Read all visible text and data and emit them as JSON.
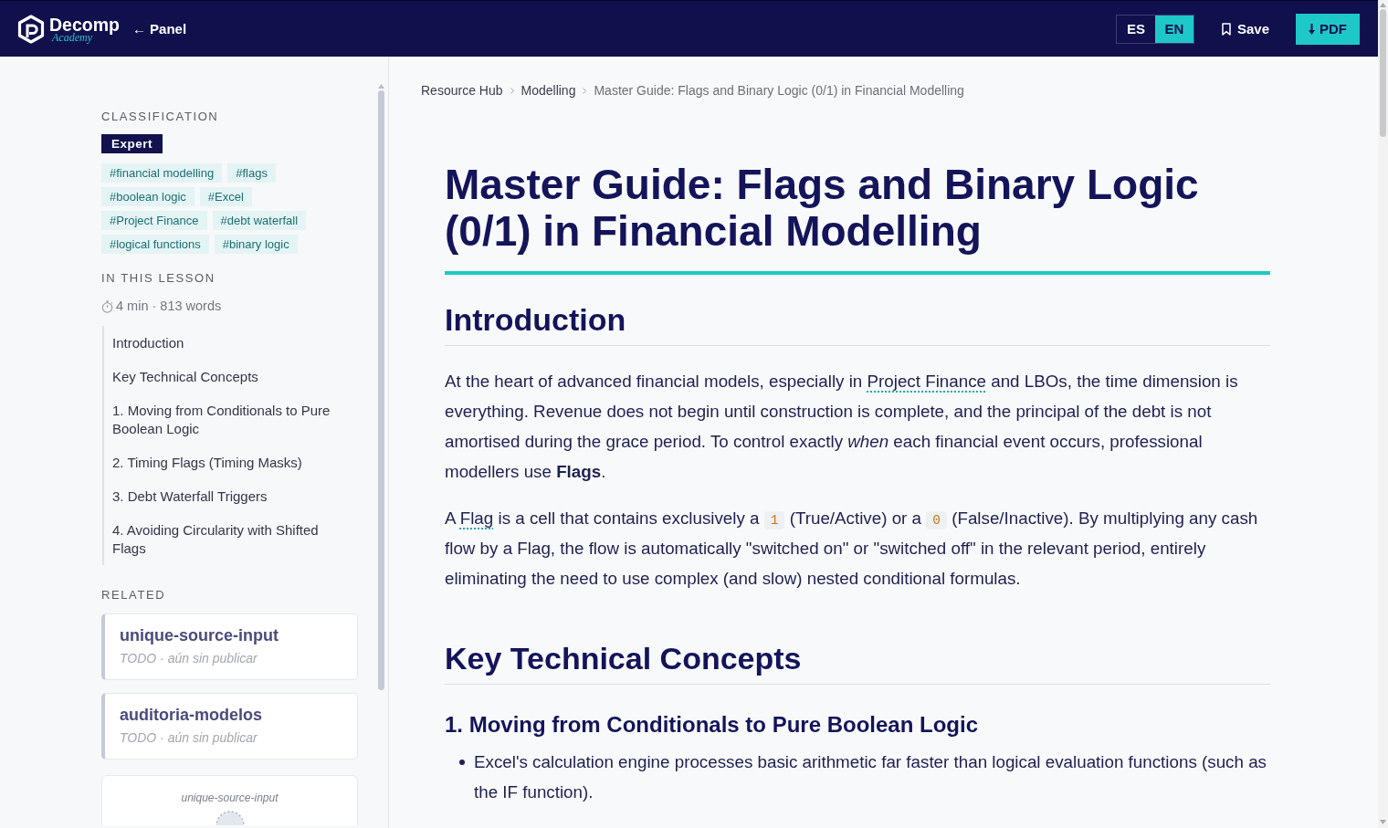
{
  "header": {
    "brand": {
      "name": "Decomp",
      "tagline": "Academy"
    },
    "back_link": "← Panel",
    "languages": [
      {
        "label": "ES",
        "selected": false
      },
      {
        "label": "EN",
        "selected": true
      }
    ],
    "save_button": "Save",
    "pdf_button": "PDF"
  },
  "sidebar": {
    "classification": {
      "heading": "CLASSIFICATION",
      "level": "Expert",
      "tags": [
        "#financial modelling",
        "#flags",
        "#boolean logic",
        "#Excel",
        "#Project Finance",
        "#debt waterfall",
        "#logical functions",
        "#binary logic"
      ]
    },
    "lesson": {
      "heading": "IN THIS LESSON",
      "reading_info": "4 min · 813 words",
      "contents": [
        "Introduction",
        "Key Technical Concepts",
        "1. Moving from Conditionals to Pure Boolean Logic",
        "2. Timing Flags (Timing Masks)",
        "3. Debt Waterfall Triggers",
        "4. Avoiding Circularity with Shifted Flags"
      ]
    },
    "related": {
      "heading": "RELATED",
      "cards": [
        {
          "kind": "card",
          "title": "unique-source-input",
          "subtitle": "TODO · aún sin publicar"
        },
        {
          "kind": "card",
          "title": "auditoria-modelos",
          "subtitle": "TODO · aún sin publicar"
        },
        {
          "kind": "preview",
          "title": "unique-source-input"
        }
      ]
    }
  },
  "breadcrumb": [
    {
      "kind": "link",
      "label": "Resource Hub"
    },
    {
      "kind": "link",
      "label": "Modelling"
    },
    {
      "kind": "current",
      "label": "Master Guide: Flags and Binary Logic (0/1) in Financial Modelling"
    }
  ],
  "article": {
    "title": "Master Guide: Flags and Binary Logic (0/1) in Financial Modelling",
    "blocks": [
      {
        "kind": "heading",
        "text": "Introduction"
      },
      {
        "kind": "paragraph",
        "parts": [
          {
            "kind": "text",
            "text": "At the heart of advanced financial models, especially in "
          },
          {
            "kind": "link",
            "text": "Project Finance"
          },
          {
            "kind": "text",
            "text": " and LBOs, the time dimension is everything. Revenue does not begin until construction is complete, and the principal of the debt is not amortised during the grace period. To control exactly *when* each financial event occurs, professional modellers use **Flags**."
          }
        ]
      },
      {
        "kind": "paragraph",
        "parts": [
          {
            "kind": "text",
            "text": "A "
          },
          {
            "kind": "link",
            "text": "Flag"
          },
          {
            "kind": "text",
            "text": " is a cell that contains exclusively a "
          },
          {
            "kind": "code",
            "text": "1"
          },
          {
            "kind": "text",
            "text": " (True/Active) or a "
          },
          {
            "kind": "code",
            "text": "0"
          },
          {
            "kind": "text",
            "text": " (False/Inactive). By multiplying any cash flow by a Flag, the flow is automatically \"switched on\" or \"switched off\" in the relevant period, entirely eliminating the need to use complex (and slow) nested conditional formulas."
          }
        ]
      },
      {
        "kind": "heading",
        "text": "Key Technical Concepts"
      },
      {
        "kind": "subheading",
        "text": "1. Moving from Conditionals to Pure Boolean Logic"
      },
      {
        "kind": "bullets",
        "items": [
          "Excel's calculation engine processes basic arithmetic far faster than logical evaluation functions (such as the IF function)."
        ]
      }
    ]
  }
}
